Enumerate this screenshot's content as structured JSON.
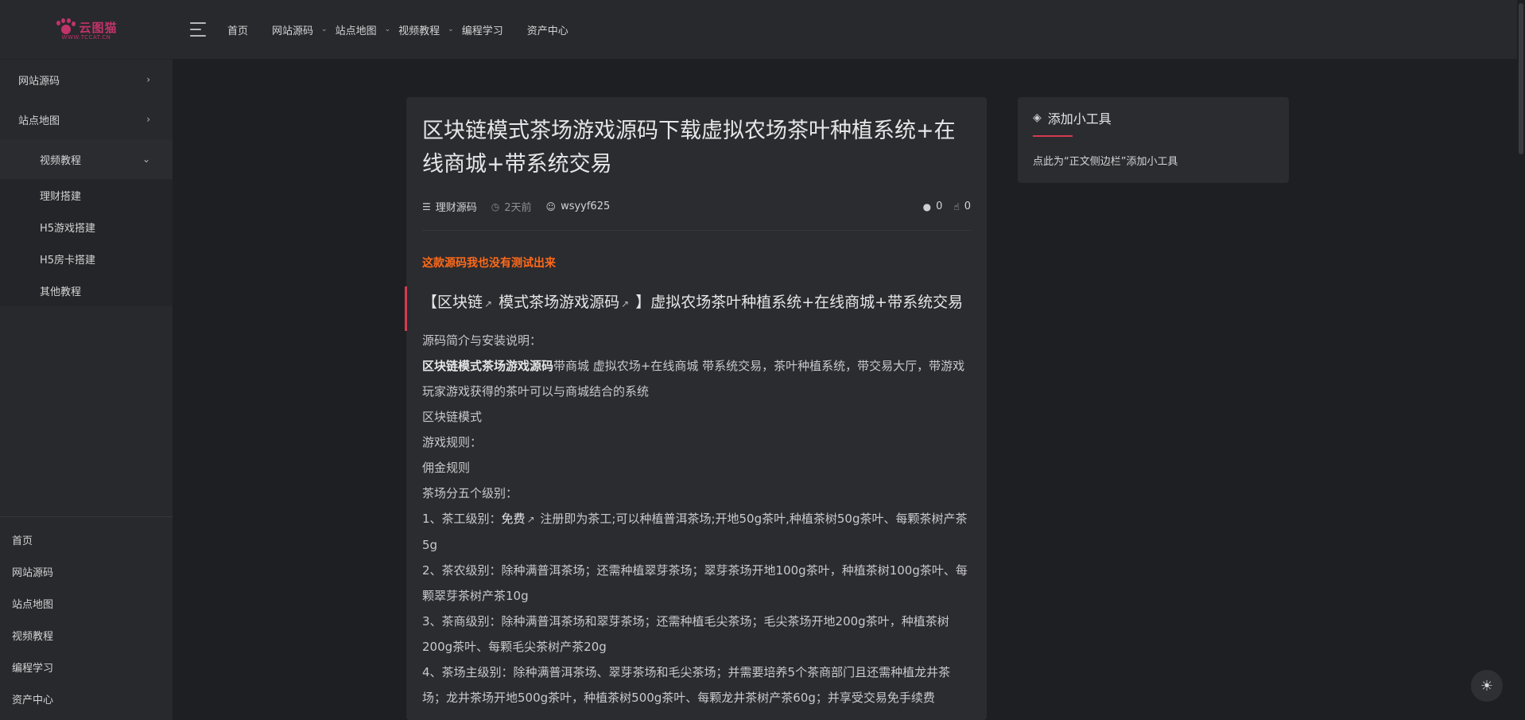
{
  "brand": {
    "logo_text": "云图猫",
    "logo_url": "WWW.TCCAT.CN",
    "accent": "#c2336b"
  },
  "sidebar": {
    "items": [
      {
        "label": "网站源码"
      },
      {
        "label": "站点地图"
      }
    ],
    "open_item": {
      "label": "视频教程"
    },
    "sub_items": [
      {
        "label": "理财搭建"
      },
      {
        "label": "H5游戏搭建"
      },
      {
        "label": "H5房卡搭建"
      },
      {
        "label": "其他教程"
      }
    ],
    "bottom_links": [
      {
        "label": "首页"
      },
      {
        "label": "网站源码"
      },
      {
        "label": "站点地图"
      },
      {
        "label": "视频教程"
      },
      {
        "label": "编程学习"
      },
      {
        "label": "资产中心"
      }
    ]
  },
  "header": {
    "nav": [
      {
        "label": "首页"
      },
      {
        "label": "网站源码"
      },
      {
        "label": "站点地图"
      },
      {
        "label": "视频教程"
      },
      {
        "label": "编程学习"
      },
      {
        "label": "资产中心"
      }
    ]
  },
  "article": {
    "title": "区块链模式茶场游戏源码下载虚拟农场茶叶种植系统+在线商城+带系统交易",
    "category": "理财源码",
    "time": "2天前",
    "author": "wsyyf625",
    "comments": "0",
    "likes": "0",
    "notice": "这款源码我也没有测试出来",
    "heading_p1": "【区块链",
    "heading_p2": " 模式茶场游戏源码",
    "heading_p3": " 】虚拟农场茶叶种植系统+在线商城+带系统交易",
    "intro_label": "源码简介与安装说明：",
    "intro_bold": "区块链模式茶场游戏源码",
    "intro_rest": "带商城 虚拟农场+在线商城 带系统交易，茶叶种植系统，带交易大厅，带游戏玩家游戏获得的茶叶可以与商城结合的系统",
    "line_mode": "区块链模式",
    "line_rules": "游戏规则：",
    "line_commission": "佣金规则",
    "line_levels": "茶场分五个级别：",
    "level1_a": "1、茶工级别：",
    "level1_b": "免费",
    "level1_c": " 注册即为茶工;可以种植普洱茶场;开地50g茶叶,种植茶树50g茶叶、每颗茶树产茶5g",
    "level2": "2、茶农级别：除种满普洱茶场；还需种植翠芽茶场；翠芽茶场开地100g茶叶，种植茶树100g茶叶、每颗翠芽茶树产茶10g",
    "level3": "3、茶商级别：除种满普洱茶场和翠芽茶场；还需种植毛尖茶场；毛尖茶场开地200g茶叶，种植茶树200g茶叶、每颗毛尖茶树产茶20g",
    "level4": "4、茶场主级别：除种满普洱茶场、翠芽茶场和毛尖茶场；并需要培养5个茶商部门且还需种植龙井茶场；龙井茶场开地500g茶叶，种植茶树500g茶叶、每颗龙井茶树产茶60g；并享受交易免手续费"
  },
  "widget": {
    "title": "添加小工具",
    "text": "点此为“正文侧边栏”添加小工具"
  },
  "colors": {
    "background": "#1e1f22",
    "panel": "#2b2c2f",
    "notice": "#ff6a1a",
    "accent_red": "#d63a4f"
  }
}
